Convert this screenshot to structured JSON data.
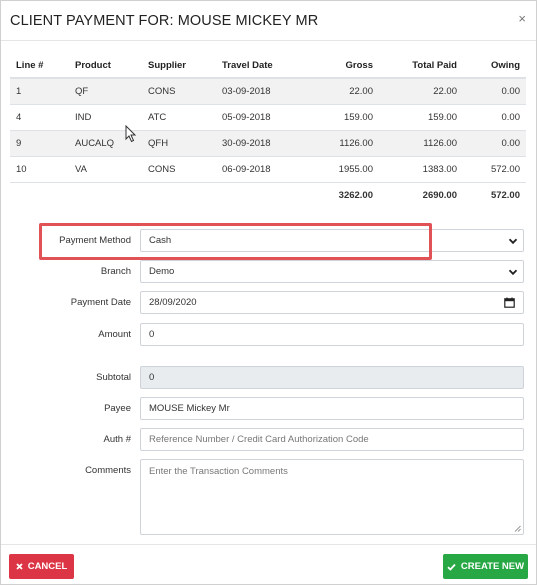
{
  "modal": {
    "title": "CLIENT PAYMENT FOR: MOUSE MICKEY MR",
    "close_label": "×"
  },
  "table": {
    "columns": [
      "Line #",
      "Product",
      "Supplier",
      "Travel Date",
      "Gross",
      "Total Paid",
      "Owing"
    ],
    "rows": [
      {
        "line": "1",
        "product": "QF",
        "supplier": "CONS",
        "travel_date": "03-09-2018",
        "gross": "22.00",
        "total_paid": "22.00",
        "owing": "0.00"
      },
      {
        "line": "4",
        "product": "IND",
        "supplier": "ATC",
        "travel_date": "05-09-2018",
        "gross": "159.00",
        "total_paid": "159.00",
        "owing": "0.00"
      },
      {
        "line": "9",
        "product": "AUCALQ",
        "supplier": "QFH",
        "travel_date": "30-09-2018",
        "gross": "1126.00",
        "total_paid": "1126.00",
        "owing": "0.00"
      },
      {
        "line": "10",
        "product": "VA",
        "supplier": "CONS",
        "travel_date": "06-09-2018",
        "gross": "1955.00",
        "total_paid": "1383.00",
        "owing": "572.00"
      }
    ],
    "totals": {
      "gross": "3262.00",
      "total_paid": "2690.00",
      "owing": "572.00"
    }
  },
  "form": {
    "payment_method": {
      "label": "Payment Method",
      "value": "Cash"
    },
    "branch": {
      "label": "Branch",
      "value": "Demo"
    },
    "payment_date": {
      "label": "Payment Date",
      "value": "28/09/2020"
    },
    "amount": {
      "label": "Amount",
      "value": "0"
    },
    "subtotal": {
      "label": "Subtotal",
      "value": "0"
    },
    "payee": {
      "label": "Payee",
      "value": "MOUSE Mickey Mr"
    },
    "auth": {
      "label": "Auth #",
      "placeholder": "Reference Number / Credit Card Authorization Code"
    },
    "comments": {
      "label": "Comments",
      "placeholder": "Enter the Transaction Comments"
    }
  },
  "footer": {
    "cancel_label": "CANCEL",
    "create_label": "CREATE NEW"
  },
  "colors": {
    "cancel": "#dc3545",
    "create": "#28a745",
    "highlight": "#e15256"
  },
  "icons": {
    "cancel": "times-icon",
    "create": "check-icon",
    "select": "chevron-down-icon",
    "date": "calendar-icon"
  }
}
